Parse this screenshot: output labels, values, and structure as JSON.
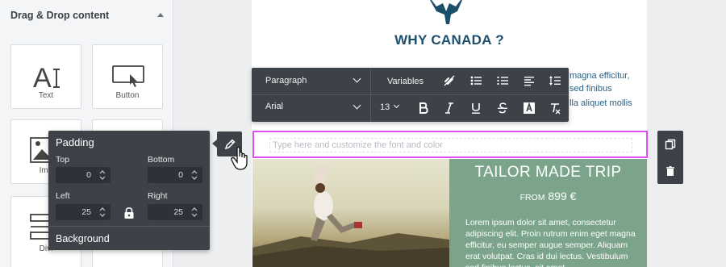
{
  "left_panel": {
    "title": "Drag & Drop content",
    "tiles": [
      {
        "label": "Text",
        "icon": "text-icon"
      },
      {
        "label": "Button",
        "icon": "button-icon"
      },
      {
        "label": "Ima",
        "icon": "image-icon"
      },
      {
        "label": "Divi",
        "icon": "divider-icon"
      }
    ]
  },
  "email": {
    "heading": "WHY CANADA ?",
    "body_lines": [
      "magna efficitur,",
      "sed finibus",
      "lla aliquet mollis"
    ],
    "text_placeholder": "Type here and customize the font and color",
    "promo": {
      "title": "TAILOR MADE TRIP",
      "from_label": "FROM",
      "price": "899 €",
      "body": "Lorem ipsum dolor sit amet, consectetur adipiscing elit. Proin rutrum enim eget magna efficitur, eu semper augue semper. Aliquam erat volutpat. Cras id dui lectus. Vestibulum sed finibus lectus, sit amet"
    }
  },
  "toolbar": {
    "format_select": "Paragraph",
    "variables_label": "Variables",
    "font_select": "Arial",
    "font_size": "13"
  },
  "padding_panel": {
    "title": "Padding",
    "top_label": "Top",
    "top_value": "0",
    "bottom_label": "Bottom",
    "bottom_value": "0",
    "left_label": "Left",
    "left_value": "25",
    "right_label": "Right",
    "right_value": "25",
    "background_label": "Background"
  },
  "colors": {
    "toolbar_bg": "#3d4148",
    "selection_border": "#e04ff0",
    "heading": "#1c4f6b",
    "promo_bg": "#7ba48b"
  }
}
